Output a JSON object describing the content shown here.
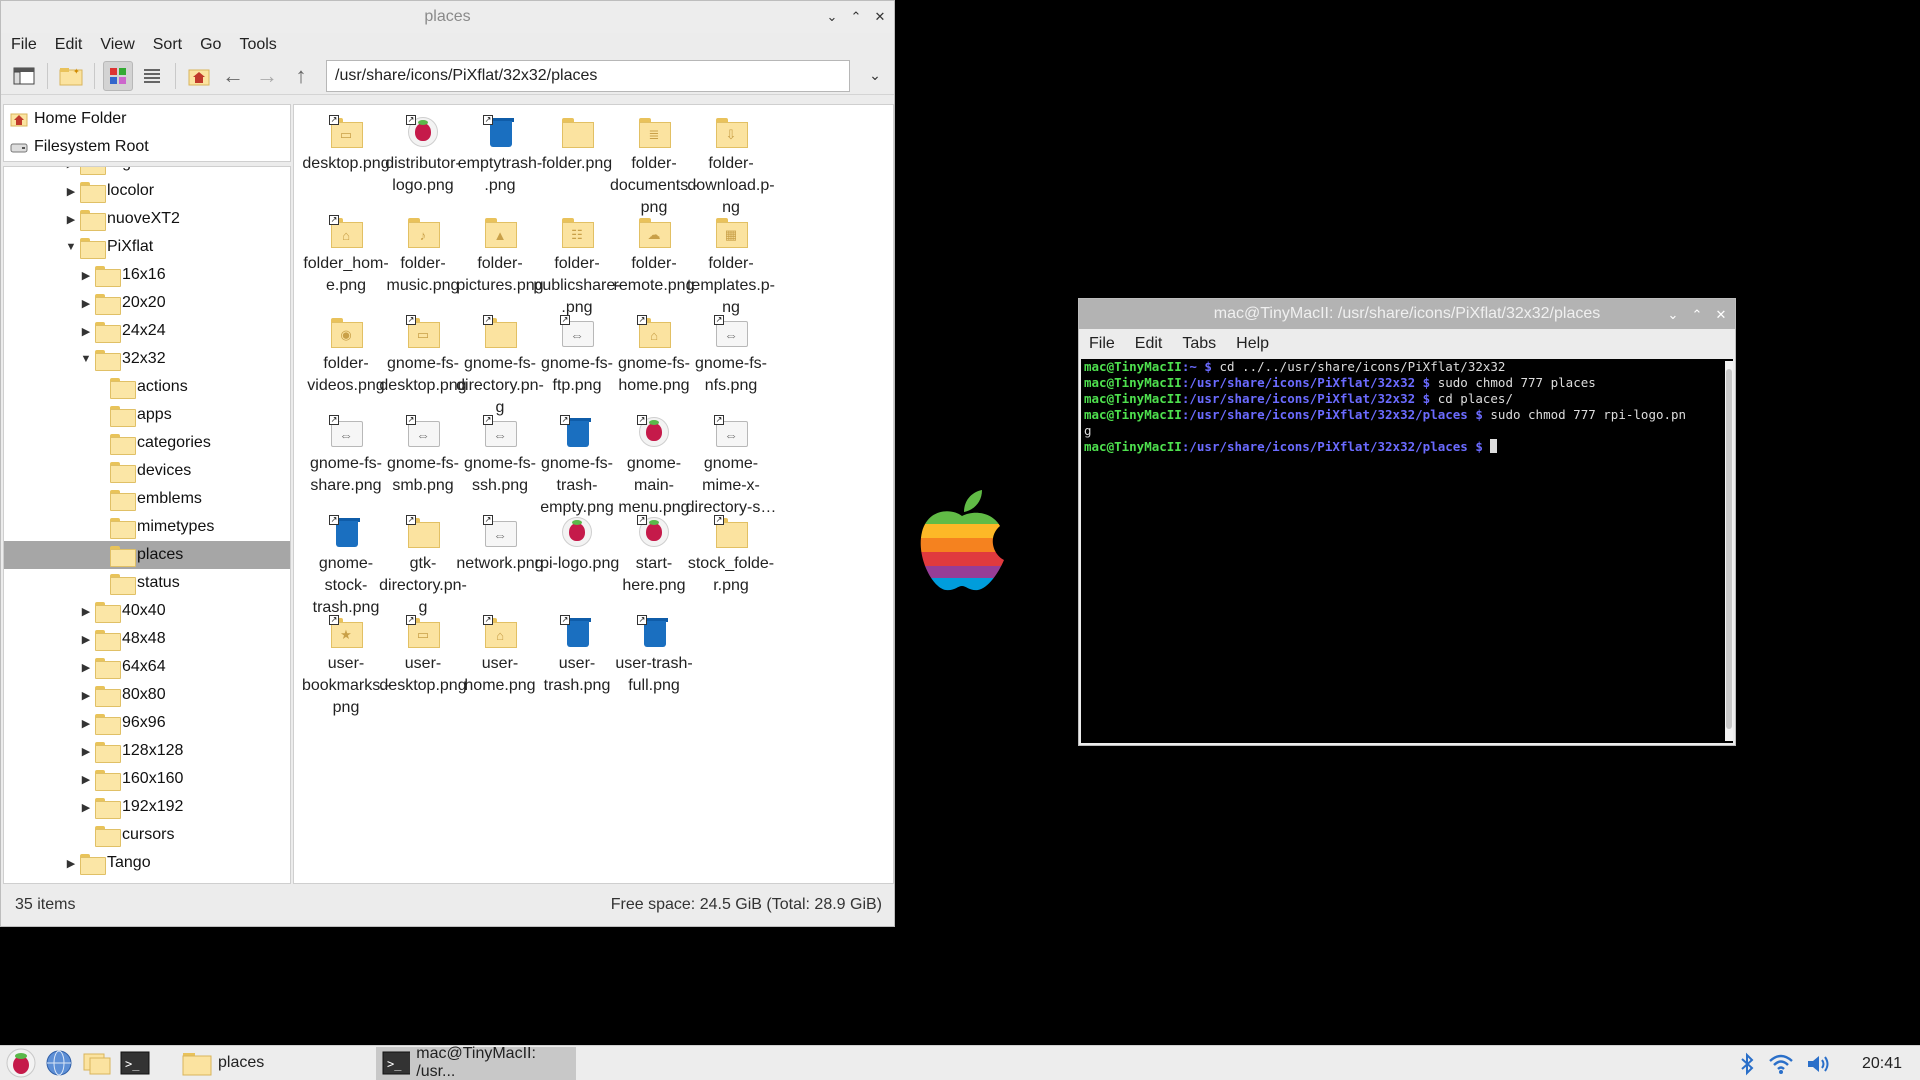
{
  "file_manager": {
    "title": "places",
    "menu": [
      "File",
      "Edit",
      "View",
      "Sort",
      "Go",
      "Tools"
    ],
    "path": "/usr/share/icons/PiXflat/32x32/places",
    "places": [
      "Home Folder",
      "Filesystem Root"
    ],
    "tree": [
      {
        "label": "HighContrast",
        "indent": 0,
        "expander": "right"
      },
      {
        "label": "locolor",
        "indent": 0,
        "expander": "right"
      },
      {
        "label": "nuoveXT2",
        "indent": 0,
        "expander": "right"
      },
      {
        "label": "PiXflat",
        "indent": 0,
        "expander": "down"
      },
      {
        "label": "16x16",
        "indent": 1,
        "expander": "right"
      },
      {
        "label": "20x20",
        "indent": 1,
        "expander": "right"
      },
      {
        "label": "24x24",
        "indent": 1,
        "expander": "right"
      },
      {
        "label": "32x32",
        "indent": 1,
        "expander": "down"
      },
      {
        "label": "actions",
        "indent": 2,
        "expander": "none"
      },
      {
        "label": "apps",
        "indent": 2,
        "expander": "none"
      },
      {
        "label": "categories",
        "indent": 2,
        "expander": "none"
      },
      {
        "label": "devices",
        "indent": 2,
        "expander": "none"
      },
      {
        "label": "emblems",
        "indent": 2,
        "expander": "none"
      },
      {
        "label": "mimetypes",
        "indent": 2,
        "expander": "none"
      },
      {
        "label": "places",
        "indent": 2,
        "expander": "none",
        "selected": true
      },
      {
        "label": "status",
        "indent": 2,
        "expander": "none"
      },
      {
        "label": "40x40",
        "indent": 1,
        "expander": "right"
      },
      {
        "label": "48x48",
        "indent": 1,
        "expander": "right"
      },
      {
        "label": "64x64",
        "indent": 1,
        "expander": "right"
      },
      {
        "label": "80x80",
        "indent": 1,
        "expander": "right"
      },
      {
        "label": "96x96",
        "indent": 1,
        "expander": "right"
      },
      {
        "label": "128x128",
        "indent": 1,
        "expander": "right"
      },
      {
        "label": "160x160",
        "indent": 1,
        "expander": "right"
      },
      {
        "label": "192x192",
        "indent": 1,
        "expander": "right"
      },
      {
        "label": "cursors",
        "indent": 1,
        "expander": "none"
      },
      {
        "label": "Tango",
        "indent": 0,
        "expander": "right"
      }
    ],
    "files": [
      {
        "label": "desktop.png",
        "lines": [
          "desktop.png"
        ],
        "icon": "folder-desktop-icon",
        "kind": "folder",
        "glyph": "▭",
        "link": true
      },
      {
        "label": "distributor-logo.png",
        "lines": [
          "distributor-",
          "logo.png"
        ],
        "icon": "raspberry-icon",
        "kind": "rpi",
        "link": true
      },
      {
        "label": "emptytrash.png",
        "lines": [
          "emptytrash-",
          ".png"
        ],
        "icon": "trash-icon",
        "kind": "trash",
        "link": true
      },
      {
        "label": "folder.png",
        "lines": [
          "folder.png"
        ],
        "icon": "folder-icon",
        "kind": "folder",
        "glyph": ""
      },
      {
        "label": "folder-documents.png",
        "lines": [
          "folder-",
          "documents.-",
          "png"
        ],
        "icon": "folder-documents-icon",
        "kind": "folder",
        "glyph": "≣"
      },
      {
        "label": "folder-download.png",
        "lines": [
          "folder-",
          "download.p-",
          "ng"
        ],
        "icon": "folder-download-icon",
        "kind": "folder",
        "glyph": "⇩"
      },
      {
        "label": "folder_home.png",
        "lines": [
          "folder_hom-",
          "e.png"
        ],
        "icon": "folder-home-icon",
        "kind": "folder",
        "glyph": "⌂",
        "link": true
      },
      {
        "label": "folder-music.png",
        "lines": [
          "folder-",
          "music.png"
        ],
        "icon": "folder-music-icon",
        "kind": "folder",
        "glyph": "♪"
      },
      {
        "label": "folder-pictures.png",
        "lines": [
          "folder-",
          "pictures.png"
        ],
        "icon": "folder-pictures-icon",
        "kind": "folder",
        "glyph": "▲"
      },
      {
        "label": "folder-publicshare.png",
        "lines": [
          "folder-",
          "publicshare-",
          ".png"
        ],
        "icon": "folder-publicshare-icon",
        "kind": "folder",
        "glyph": "☷"
      },
      {
        "label": "folder-remote.png",
        "lines": [
          "folder-",
          "remote.png"
        ],
        "icon": "folder-remote-icon",
        "kind": "folder",
        "glyph": "☁"
      },
      {
        "label": "folder-templates.png",
        "lines": [
          "folder-",
          "templates.p-",
          "ng"
        ],
        "icon": "folder-templates-icon",
        "kind": "folder",
        "glyph": "▦"
      },
      {
        "label": "folder-videos.png",
        "lines": [
          "folder-",
          "videos.png"
        ],
        "icon": "folder-videos-icon",
        "kind": "folder",
        "glyph": "◉"
      },
      {
        "label": "gnome-fs-desktop.png",
        "lines": [
          "gnome-fs-",
          "desktop.png"
        ],
        "icon": "folder-desktop-icon",
        "kind": "folder",
        "glyph": "▭",
        "link": true
      },
      {
        "label": "gnome-fs-directory.png",
        "lines": [
          "gnome-fs-",
          "directory.pn-",
          "g"
        ],
        "icon": "folder-icon",
        "kind": "folder",
        "glyph": "",
        "link": true
      },
      {
        "label": "gnome-fs-ftp.png",
        "lines": [
          "gnome-fs-",
          "ftp.png"
        ],
        "icon": "network-icon",
        "kind": "remote",
        "glyph": "⇔",
        "link": true
      },
      {
        "label": "gnome-fs-home.png",
        "lines": [
          "gnome-fs-",
          "home.png"
        ],
        "icon": "folder-home-icon",
        "kind": "folder",
        "glyph": "⌂",
        "link": true
      },
      {
        "label": "gnome-fs-nfs.png",
        "lines": [
          "gnome-fs-",
          "nfs.png"
        ],
        "icon": "network-icon",
        "kind": "remote",
        "glyph": "⇔",
        "link": true
      },
      {
        "label": "gnome-fs-share.png",
        "lines": [
          "gnome-fs-",
          "share.png"
        ],
        "icon": "network-icon",
        "kind": "remote",
        "glyph": "⇔",
        "link": true
      },
      {
        "label": "gnome-fs-smb.png",
        "lines": [
          "gnome-fs-",
          "smb.png"
        ],
        "icon": "network-icon",
        "kind": "remote",
        "glyph": "⇔",
        "link": true
      },
      {
        "label": "gnome-fs-ssh.png",
        "lines": [
          "gnome-fs-",
          "ssh.png"
        ],
        "icon": "network-icon",
        "kind": "remote",
        "glyph": "⇔",
        "link": true
      },
      {
        "label": "gnome-fs-trash-empty.png",
        "lines": [
          "gnome-fs-",
          "trash-",
          "empty.png"
        ],
        "icon": "trash-icon",
        "kind": "trash",
        "link": true
      },
      {
        "label": "gnome-main-menu.png",
        "lines": [
          "gnome-",
          "main-",
          "menu.png"
        ],
        "icon": "raspberry-icon",
        "kind": "rpi",
        "link": true
      },
      {
        "label": "gnome-mime-x-directory-s…",
        "lines": [
          "gnome-",
          "mime-x-",
          "directory-s…"
        ],
        "icon": "network-icon",
        "kind": "remote",
        "glyph": "⇔",
        "link": true
      },
      {
        "label": "gnome-stock-trash.png",
        "lines": [
          "gnome-",
          "stock-",
          "trash.png"
        ],
        "icon": "trash-icon",
        "kind": "trash",
        "link": true
      },
      {
        "label": "gtk-directory.png",
        "lines": [
          "gtk-",
          "directory.pn-",
          "g"
        ],
        "icon": "folder-icon",
        "kind": "folder",
        "glyph": "",
        "link": true
      },
      {
        "label": "network.png",
        "lines": [
          "network.png"
        ],
        "icon": "network-icon",
        "kind": "remote",
        "glyph": "⇔",
        "link": true
      },
      {
        "label": "rpi-logo.png",
        "lines": [
          "rpi-logo.png"
        ],
        "icon": "raspberry-icon",
        "kind": "rpi"
      },
      {
        "label": "start-here.png",
        "lines": [
          "start-",
          "here.png"
        ],
        "icon": "raspberry-icon",
        "kind": "rpi",
        "link": true
      },
      {
        "label": "stock_folder.png",
        "lines": [
          "stock_folde-",
          "r.png"
        ],
        "icon": "folder-icon",
        "kind": "folder",
        "glyph": "",
        "link": true
      },
      {
        "label": "user-bookmarks.png",
        "lines": [
          "user-",
          "bookmarks.-",
          "png"
        ],
        "icon": "folder-bookmarks-icon",
        "kind": "folder",
        "glyph": "★",
        "link": true
      },
      {
        "label": "user-desktop.png",
        "lines": [
          "user-",
          "desktop.png"
        ],
        "icon": "folder-desktop-icon",
        "kind": "folder",
        "glyph": "▭",
        "link": true
      },
      {
        "label": "user-home.png",
        "lines": [
          "user-",
          "home.png"
        ],
        "icon": "folder-home-icon",
        "kind": "folder",
        "glyph": "⌂",
        "link": true
      },
      {
        "label": "user-trash.png",
        "lines": [
          "user-",
          "trash.png"
        ],
        "icon": "trash-icon",
        "kind": "trash",
        "link": true
      },
      {
        "label": "user-trash-full.png",
        "lines": [
          "user-trash-",
          "full.png"
        ],
        "icon": "trash-full-icon",
        "kind": "trash",
        "link": true
      }
    ],
    "status_left": "35 items",
    "status_right": "Free space: 24.5 GiB (Total: 28.9 GiB)"
  },
  "terminal": {
    "title": "mac@TinyMacII: /usr/share/icons/PiXflat/32x32/places",
    "menu": [
      "File",
      "Edit",
      "Tabs",
      "Help"
    ],
    "lines": [
      {
        "user": "mac@TinyMacII",
        "path": ":~ $",
        "cmd": " cd ../../usr/share/icons/PiXflat/32x32"
      },
      {
        "user": "mac@TinyMacII",
        "path": ":/usr/share/icons/PiXflat/32x32 $",
        "cmd": " sudo chmod 777 places"
      },
      {
        "user": "mac@TinyMacII",
        "path": ":/usr/share/icons/PiXflat/32x32 $",
        "cmd": " cd places/"
      },
      {
        "user": "mac@TinyMacII",
        "path": ":/usr/share/icons/PiXflat/32x32/places $",
        "cmd": " sudo chmod 777 rpi-logo.pn"
      },
      {
        "user": "",
        "path": "",
        "cmd": "g"
      },
      {
        "user": "mac@TinyMacII",
        "path": ":/usr/share/icons/PiXflat/32x32/places $",
        "cmd": " ",
        "cursor": true
      }
    ]
  },
  "taskbar": {
    "task1": "places",
    "task2": "mac@TinyMacII: /usr...",
    "clock": "20:41"
  },
  "colors": {
    "rpi_red": "#c51a4a",
    "prompt_green": "#4ee04e",
    "prompt_blue": "#6b6bff",
    "trash_blue": "#1a6fc0"
  }
}
